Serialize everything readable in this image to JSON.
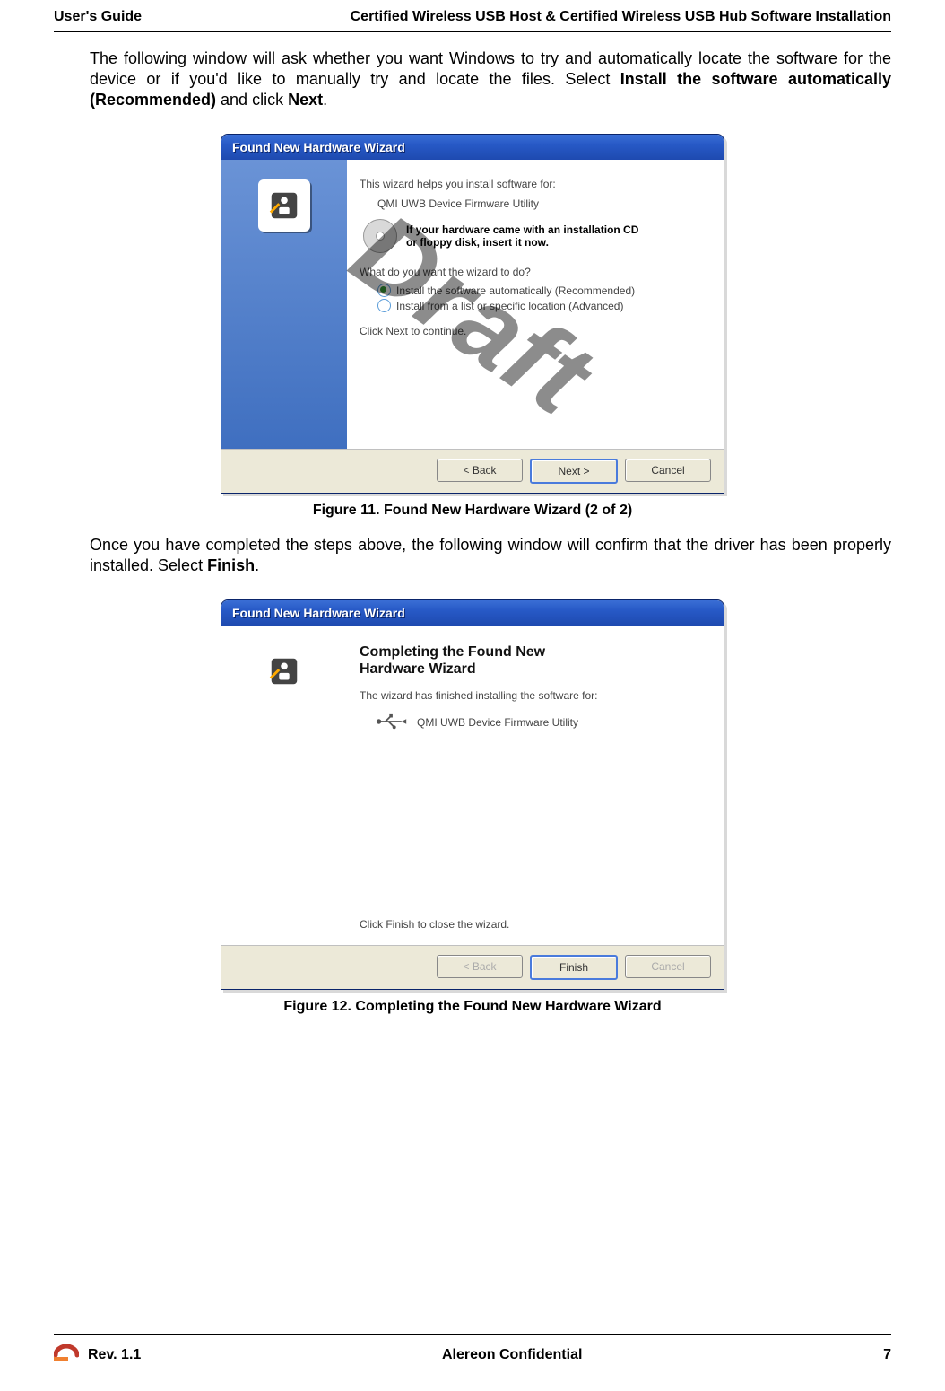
{
  "header": {
    "left": "User's Guide",
    "right": "Certified Wireless USB Host & Certified Wireless USB Hub Software Installation"
  },
  "para1_pre": "The following window will ask whether you want Windows to try and automatically locate the software for the device or if you'd like to manually try and locate the files. Select ",
  "para1_bold": "Install the software automatically (Recommended)",
  "para1_mid": " and click ",
  "para1_bold2": "Next",
  "para1_post": ".",
  "dialog1": {
    "title": "Found New Hardware Wizard",
    "line1": "This wizard helps you install software for:",
    "device": "QMI UWB Device Firmware Utility",
    "cd_l1": "If your hardware came with an installation CD",
    "cd_l2": "or floppy disk, insert it now.",
    "q": "What do you want the wizard to do?",
    "opt1": "Install the software automatically (Recommended)",
    "opt2": "Install from a list or specific location (Advanced)",
    "cont": "Click Next to continue.",
    "btn_back": "< Back",
    "btn_next": "Next >",
    "btn_cancel": "Cancel"
  },
  "caption1": "Figure 11.    Found New Hardware Wizard (2 of 2)",
  "para2_pre": "Once you have completed the steps above, the following window will confirm that the driver has been properly installed. Select ",
  "para2_bold": "Finish",
  "para2_post": ".",
  "dialog2": {
    "title": "Found New Hardware Wizard",
    "heading_a": "Completing the Found New",
    "heading_b": "Hardware Wizard",
    "line1": "The wizard has finished installing the software for:",
    "device": "QMI UWB Device Firmware Utility",
    "close": "Click Finish to close the wizard.",
    "btn_back": "< Back",
    "btn_finish": "Finish",
    "btn_cancel": "Cancel"
  },
  "caption2": "Figure 12.    Completing the Found New Hardware Wizard",
  "watermark": "Draft",
  "footer": {
    "rev": "Rev. 1.1",
    "center": "Alereon Confidential",
    "page": "7"
  }
}
